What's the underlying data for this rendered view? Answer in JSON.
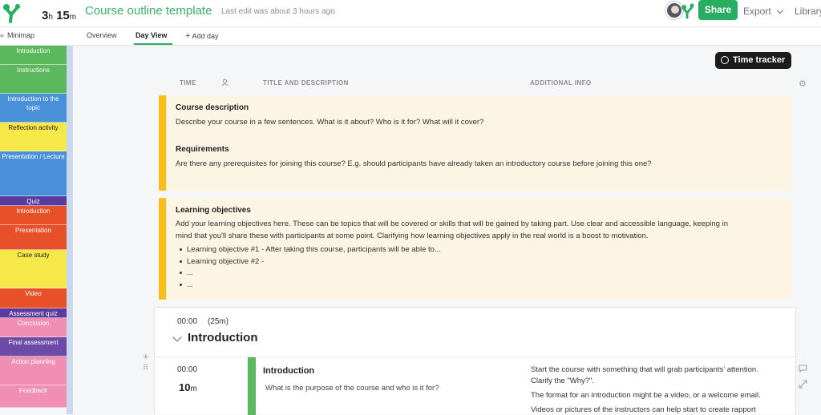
{
  "header": {
    "duration_hours": "3",
    "duration_hours_unit": "h",
    "duration_minutes": "15",
    "duration_minutes_unit": "m",
    "title": "Course outline template",
    "last_edit": "Last edit was about 3 hours ago",
    "share_label": "Share",
    "export_label": "Export",
    "library_label": "Library"
  },
  "tabs": {
    "minimap_label": "Minimap",
    "overview": "Overview",
    "day_view": "Day View",
    "add_day": "Add day"
  },
  "sidebar": {
    "items": [
      {
        "label": "Introduction",
        "color": "#5cb85c"
      },
      {
        "label": "Instructions",
        "color": "#5cb85c"
      },
      {
        "label": "Introduction to the topic",
        "color": "#4a90d9"
      },
      {
        "label": "Reflection activity",
        "color": "#f7e84a"
      },
      {
        "label": "Presentation / Lecture",
        "color": "#4a90d9"
      },
      {
        "label": "Quiz",
        "color": "#5b3a9e"
      },
      {
        "label": "Introduction",
        "color": "#e8502a"
      },
      {
        "label": "Presentation",
        "color": "#e8502a"
      },
      {
        "label": "Case study",
        "color": "#f7e84a"
      },
      {
        "label": "Video",
        "color": "#e8502a"
      },
      {
        "label": "Assessment quiz",
        "color": "#5b3a9e"
      },
      {
        "label": "Conclusion",
        "color": "#f08fb3"
      },
      {
        "label": "Final assessment",
        "color": "#6b4aa8"
      },
      {
        "label": "Action planning",
        "color": "#f08fb3"
      },
      {
        "label": "Feedback",
        "color": "#f08fb3"
      }
    ]
  },
  "time_tracker_label": "Time tracker",
  "columns": {
    "time": "TIME",
    "title": "TITLE AND DESCRIPTION",
    "info": "ADDITIONAL INFO"
  },
  "notes": {
    "course_heading": "Course description",
    "course_text": "Describe your course in a few sentences. What is it about? Who is it for? What will it cover?",
    "req_heading": "Requirements",
    "req_text": "Are there any prerequisites for joining this course? E.g. should participants have already taken an introductory course before joining this one?",
    "lo_heading": "Learning objectives",
    "lo_line1": "Add your learning objectives here. These can be topics that will be covered or skills that will be gained by taking part. Use clear and accessible language, keeping in",
    "lo_line2": "mind that you'll share these with participants at some point. Clarifying how learning objectives apply in the real world is a boost to motivation.",
    "lo_bullets": [
      "Learning objective #1 - After taking this course, participants will be able to...",
      "Learning objective #2 -",
      "...",
      "..."
    ]
  },
  "section": {
    "time": "00:00",
    "duration": "(25m)",
    "title": "Introduction",
    "activity": {
      "time": "00:00",
      "duration_value": "10",
      "duration_unit": "m",
      "title": "Introduction",
      "description": "What is the purpose of the course and who is it for?",
      "info_lines": [
        "Start the course with something that will grab participants' attention.",
        "Clarify the \"Why?\".",
        "The format for an introduction might be a video, or a welcome email.",
        "Videos or pictures of the instructors can help start to create rapport"
      ]
    }
  }
}
